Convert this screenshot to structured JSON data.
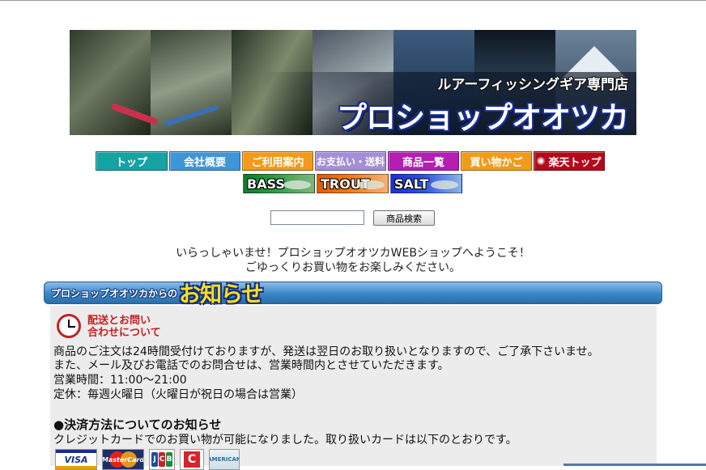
{
  "banner": {
    "subtitle": "ルアーフィッシングギア専門店",
    "title": "プロショップオオツカ"
  },
  "nav": {
    "items": [
      {
        "label": "トップ"
      },
      {
        "label": "会社概要"
      },
      {
        "label": "ご利用案内"
      },
      {
        "label": "お支払い・送料"
      },
      {
        "label": "商品一覧"
      },
      {
        "label": "買い物かご"
      },
      {
        "label": "楽天トップ"
      }
    ]
  },
  "categories": [
    {
      "label": "BASS"
    },
    {
      "label": "TROUT"
    },
    {
      "label": "SALT"
    }
  ],
  "search": {
    "value": "",
    "button_label": "商品検索"
  },
  "welcome": {
    "line1": "いらっしゃいませ！プロショップオオツカWEBショップへようこそ！",
    "line2": "ごゆっくりお買い物をお楽しみください。"
  },
  "notice": {
    "header_small": "プロショップオオツカからの",
    "header_big": "お知らせ",
    "section_title_1": "配送とお問い",
    "section_title_2": "合わせについて",
    "lines": [
      "商品のご注文は24時間受付けておりますが、発送は翌日のお取り扱いとなりますので、ご了承下さいませ。",
      "また、メール及びお電話でのお問合せは、営業時間内とさせていただきます。",
      "営業時間：11:00〜21:00",
      "定休：毎週火曜日（火曜日が祝日の場合は営業）"
    ],
    "payment_title": "●決済方法についてのお知らせ",
    "payment_body": "クレジットカードでのお買い物が可能になりました。取り扱いカードは以下のとおりです。"
  },
  "cards": {
    "visa": "VISA",
    "mastercard": "MasterCard",
    "jcb": [
      "J",
      "C",
      "B"
    ],
    "diners": "C",
    "amex": "AMERICAN"
  },
  "colors": {
    "nav_top": "#16a3a4",
    "nav_company": "#3e95d8",
    "nav_guide": "#f29a1a",
    "nav_payment": "#a58ed6",
    "nav_list": "#b51eb2",
    "nav_cart": "#f29a1a",
    "nav_rakuten": "#b4091c",
    "notice_title": "#c81e1e"
  }
}
